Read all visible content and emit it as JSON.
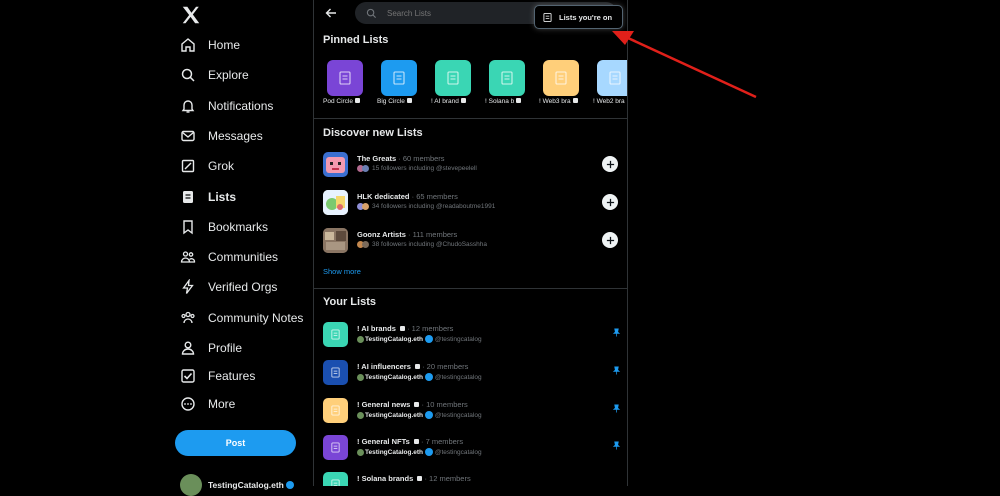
{
  "sidebar": {
    "items": [
      {
        "label": "Home"
      },
      {
        "label": "Explore"
      },
      {
        "label": "Notifications"
      },
      {
        "label": "Messages"
      },
      {
        "label": "Grok"
      },
      {
        "label": "Lists"
      },
      {
        "label": "Bookmarks"
      },
      {
        "label": "Communities"
      },
      {
        "label": "Verified Orgs"
      },
      {
        "label": "Community Notes"
      },
      {
        "label": "Profile"
      },
      {
        "label": "Features"
      },
      {
        "label": "More"
      }
    ],
    "post_label": "Post",
    "account_name": "TestingCatalog.eth"
  },
  "search": {
    "placeholder": "Search Lists"
  },
  "lists_on_label": "Lists you're on",
  "pinned": {
    "title": "Pinned Lists",
    "items": [
      {
        "label": "Pod Circle",
        "color": "#7a45d6"
      },
      {
        "label": "Big Circle",
        "color": "#1d9bf0"
      },
      {
        "label": "! AI brand",
        "color": "#3ad6b4"
      },
      {
        "label": "! Solana b",
        "color": "#3ad6b4"
      },
      {
        "label": "! Web3 bra",
        "color": "#ffcf7a"
      },
      {
        "label": "! Web2 bra",
        "color": "#a7d8ff"
      }
    ]
  },
  "discover": {
    "title": "Discover new Lists",
    "items": [
      {
        "name": "The Greats",
        "members": "· 60 members",
        "sub": "15 followers including @stevepeelell"
      },
      {
        "name": "HLK dedicated",
        "members": "· 65 members",
        "sub": "34 followers including @readaboutme1991"
      },
      {
        "name": "Goonz Artists",
        "members": "· 111 members",
        "sub": "38 followers including @ChudoSasshha"
      }
    ],
    "show_more": "Show more"
  },
  "your_lists": {
    "title": "Your Lists",
    "owner": "TestingCatalog.eth",
    "handle": "@testingcatalog",
    "items": [
      {
        "name": "! AI brands",
        "members": "· 12 members",
        "color": "#3ad6b4"
      },
      {
        "name": "! AI influencers",
        "members": "· 20 members",
        "color": "#1a4fb0"
      },
      {
        "name": "! General news",
        "members": "· 10 members",
        "color": "#ffcf7a"
      },
      {
        "name": "! General NFTs",
        "members": "· 7 members",
        "color": "#7a45d6"
      },
      {
        "name": "! Solana brands",
        "members": "· 12 members",
        "color": "#3ad6b4"
      }
    ]
  },
  "colors": {
    "accent": "#1d9bf0",
    "annotation_arrow": "#e0201a"
  }
}
